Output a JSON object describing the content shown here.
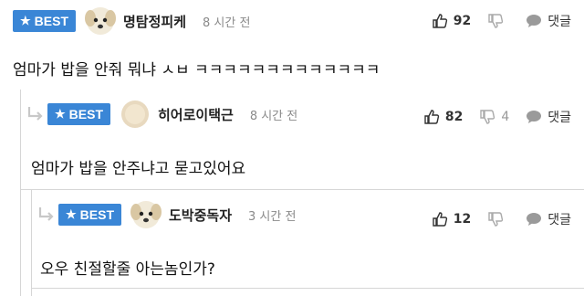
{
  "badge_label": "BEST",
  "reply_label": "댓글",
  "comments": [
    {
      "nickname": "명탐정피케",
      "time": "8 시간 전",
      "likes": "92",
      "dislikes": "",
      "text": "엄마가 밥을 안줘 뭐냐 ㅅㅂ ㅋㅋㅋㅋㅋㅋㅋㅋㅋㅋㅋㅋㅋ"
    },
    {
      "nickname": "히어로이택근",
      "time": "8 시간 전",
      "likes": "82",
      "dislikes": "4",
      "text": "엄마가 밥을 안주냐고 묻고있어요"
    },
    {
      "nickname": "도박중독자",
      "time": "3 시간 전",
      "likes": "12",
      "dislikes": "",
      "text": "오우 친절할줄 아는놈인가?"
    }
  ],
  "colors": {
    "badge": "#3a86d6",
    "divider": "#d6d6d6"
  }
}
